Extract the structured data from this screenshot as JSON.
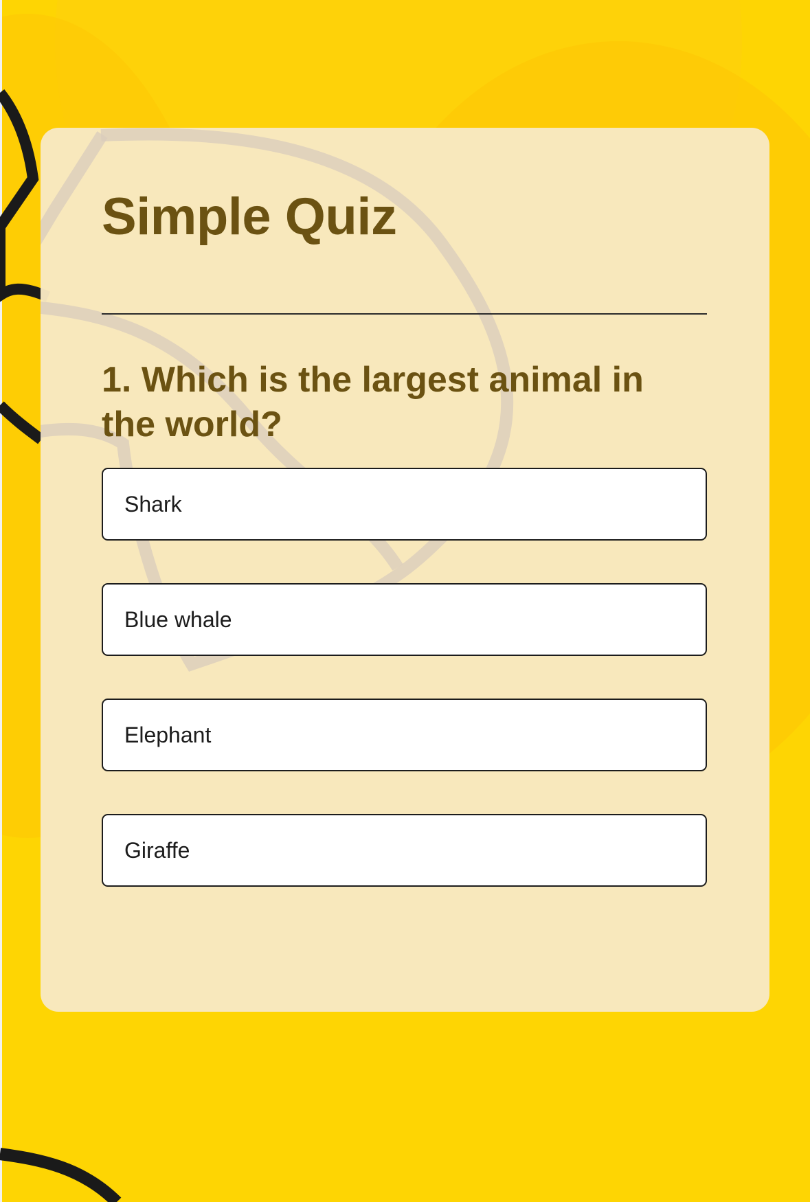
{
  "quiz": {
    "title": "Simple Quiz",
    "question": "1. Which is the largest animal in the world?",
    "options": [
      {
        "label": "Shark"
      },
      {
        "label": "Blue whale"
      },
      {
        "label": "Elephant"
      },
      {
        "label": "Giraffe"
      }
    ]
  },
  "colors": {
    "background": "#fed503",
    "card": "#f8e8c2",
    "heading": "#6b5212",
    "option_bg": "#ffffff",
    "option_border": "#1c1c1c"
  }
}
